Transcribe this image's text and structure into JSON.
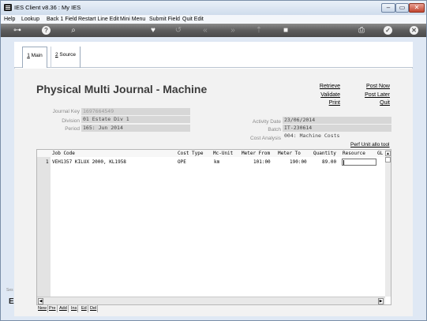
{
  "window": {
    "title": "IES Client v8.36 : My IES",
    "min_glyph": "–",
    "max_glyph": "▭",
    "close_glyph": "✕"
  },
  "menu": [
    "Help",
    "Lookup",
    "Back 1 Field",
    "Restart Line Edit",
    "Mini Menu",
    "Submit Field",
    "Quit Edit"
  ],
  "toolbar": {
    "icons": [
      "key-icon",
      "help-icon",
      "search-icon",
      "heart-icon",
      "undo-icon",
      "rewind-icon",
      "fast-forward-icon",
      "upload-icon",
      "stop-icon",
      "print-icon",
      "ok-icon",
      "close-icon"
    ],
    "help_glyph": "?",
    "search_glyph": "⌕",
    "rewind_glyph": "«",
    "forward_glyph": "»",
    "ok_glyph": "✓",
    "close_glyph": "✕"
  },
  "tabs": [
    {
      "key": "1",
      "label": "Main"
    },
    {
      "key": "2",
      "label": "Source"
    }
  ],
  "page": {
    "title": "Physical Multi Journal - Machine"
  },
  "actions": {
    "retrieve": "Retrieve",
    "validate": "Validate",
    "print": "Print",
    "post_now": "Post Now",
    "post_later": "Post Later",
    "quit": "Quit"
  },
  "fields": {
    "journal_key_label": "Journal Key",
    "journal_key_value": "1697664549",
    "division_label": "Division",
    "division_value": "01 Estate Div 1",
    "period_label": "Period",
    "period_value": "165: Jun 2014",
    "activity_date_label": "Activity Date",
    "activity_date_value": "23/06/2014",
    "batch_label": "Batch",
    "batch_value": "IT-230614",
    "cost_analysis_label": "Cost Analysis",
    "cost_analysis_value": "004: Machine Costs"
  },
  "perf_link": "Perf Unit allo tool",
  "grid": {
    "columns": [
      "Job Code",
      "Cost Type",
      "Mc-Unit",
      "Meter From",
      "Meter To",
      "Quantity",
      "Resource",
      "GL"
    ],
    "rows": [
      {
        "num": "1",
        "job_code": "VEH1357 KILUX 2000, KL1958",
        "cost_type": "OPE",
        "mc_unit": "km",
        "meter_from": "101:00",
        "meter_to": "190:00",
        "quantity": "89.00",
        "resource": "",
        "gl": ""
      }
    ]
  },
  "grid_buttons": [
    "New",
    "Pre",
    "Add",
    "Ins",
    "Ed",
    "Del"
  ],
  "side": {
    "label": "Ses",
    "icon_glyph": "E"
  }
}
